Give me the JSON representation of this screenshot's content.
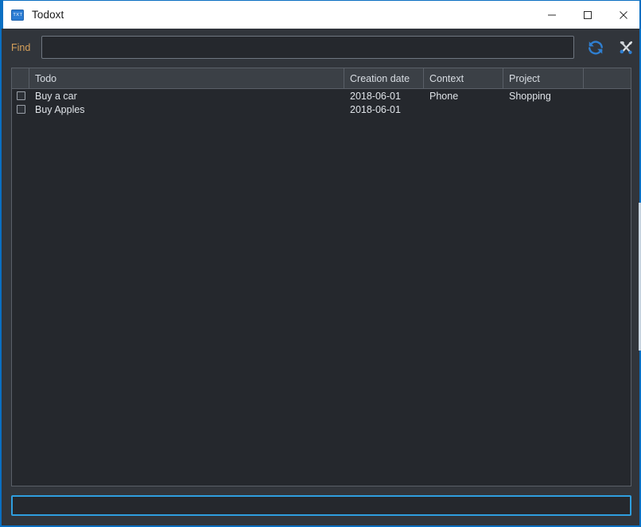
{
  "window": {
    "title": "Todoxt",
    "icon": "txt-file-icon",
    "icon_text": "TXT",
    "accent_color": "#0a6fc2",
    "controls": {
      "minimize": "minimize-icon",
      "maximize": "maximize-icon",
      "close": "close-icon"
    }
  },
  "toolbar": {
    "find_label": "Find",
    "find_value": "",
    "find_placeholder": "",
    "refresh_icon": "refresh-icon",
    "settings_icon": "tools-icon"
  },
  "table": {
    "sort_indicator": "sort-ascending-icon",
    "sort_column": "Todo",
    "columns": [
      {
        "key": "check",
        "label": ""
      },
      {
        "key": "todo",
        "label": "Todo"
      },
      {
        "key": "date",
        "label": "Creation date"
      },
      {
        "key": "context",
        "label": "Context"
      },
      {
        "key": "project",
        "label": "Project"
      },
      {
        "key": "end",
        "label": ""
      }
    ],
    "rows": [
      {
        "checked": false,
        "todo": "Buy a car",
        "date": "2018-06-01",
        "context": "Phone",
        "project": "Shopping"
      },
      {
        "checked": false,
        "todo": "Buy Apples",
        "date": "2018-06-01",
        "context": "",
        "project": ""
      }
    ]
  },
  "new_todo": {
    "value": "",
    "placeholder": ""
  }
}
